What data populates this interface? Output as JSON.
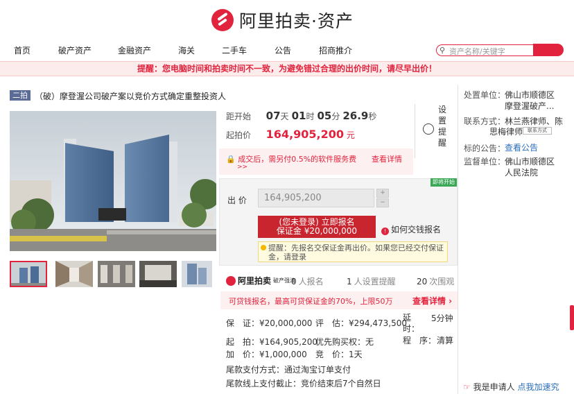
{
  "brand": {
    "name": "阿里拍卖·资产"
  },
  "nav": {
    "items": [
      "首页",
      "破产资产",
      "金融资产",
      "海关",
      "二手车",
      "公告",
      "招商推介"
    ]
  },
  "search": {
    "placeholder": "资产名称/关键字"
  },
  "notice": "提醒：您电脑时间和拍卖时间不一致，为避免错过合理的出价时间，请尽早出价！",
  "auction": {
    "tag": "二拍",
    "title": "（破）摩登渥公司破产案以竞价方式确定重整投资人"
  },
  "countdown": {
    "label": "距开始",
    "days": "07",
    "days_unit": "天",
    "hours": "01",
    "hours_unit": "时",
    "minutes": "05",
    "minutes_unit": "分",
    "seconds": "26.9",
    "seconds_unit": "秒"
  },
  "start_price": {
    "label": "起拍价",
    "value": "164,905,200",
    "unit": "元"
  },
  "fee": {
    "text": "成交后，需另付0.5%的软件服务费",
    "link": "查看详情",
    "more": ">>"
  },
  "remind": {
    "label": "设置提醒"
  },
  "bid": {
    "badge": "即将开始",
    "label": "出 价",
    "input_value": "164,905,200",
    "register_line1": "(您未登录) 立即报名",
    "register_line2": "保证金 ¥20,000,000",
    "howto": "如何交钱报名",
    "howto_icon": "!",
    "tip": "提醒：先报名交保证金再出价。如果您已经交付保证金，请登录"
  },
  "stats": {
    "logo_name": "阿里拍卖",
    "logo_sub": "破产强清",
    "signups_num": "0",
    "signups_label": "人报名",
    "reminders_num": "1",
    "reminders_label": "人设置提醒",
    "views_num": "20",
    "views_label": "次围观"
  },
  "loan": {
    "text": "可贷钱报名，最高可贷保证金的70%，上限50万",
    "link": "查看详情 ›"
  },
  "details": {
    "deposit": "保　证：¥20,000,000",
    "appraisal": "评　估：¥294,473,500",
    "delay_label": "延　时：",
    "delay_value": "5分钟",
    "start_price": "起　拍：¥164,905,200",
    "priority": "优先购买权：无",
    "procedure_label": "程　序：",
    "procedure_value": "清算",
    "increment": "加　价：¥1,000,000",
    "cycle": "竞　价：1天",
    "payment_method": "尾款支付方式：通过淘宝订单支付",
    "payment_deadline": "尾款线上支付截止：竞价结束后7个自然日"
  },
  "right": {
    "unit_label": "处置单位：",
    "unit_value1": "佛山市顺德区",
    "unit_value2": "摩登渥破产...",
    "contact_label": "联系方式：",
    "contact_value1": "林兰燕律师、陈",
    "contact_value2": "思梅律师",
    "contact_btn": "联系方式",
    "notice_label": "标的公告：",
    "notice_link": "查看公告",
    "supervisor_label": "监督单位：",
    "supervisor_value1": "佛山市顺德区",
    "supervisor_value2": "人民法院",
    "applicant_text": "我是申请人",
    "applicant_link": "点我加速",
    "applicant_tail": "究"
  }
}
